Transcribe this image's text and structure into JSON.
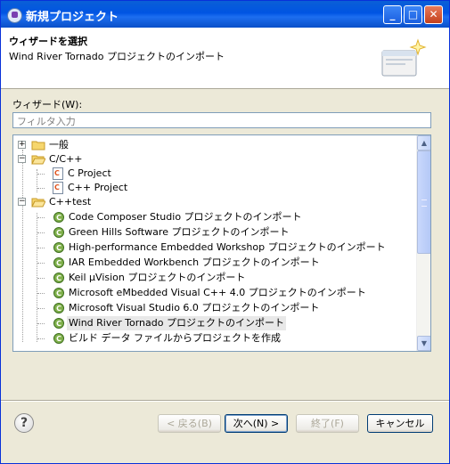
{
  "window": {
    "title": "新規プロジェクト"
  },
  "header": {
    "title": "ウィザードを選択",
    "description": "Wind River Tornado プロジェクトのインポート"
  },
  "wizards": {
    "label": "ウィザード(W):",
    "filter_placeholder": "フィルタ入力"
  },
  "tree": [
    {
      "label": "一般",
      "level": 0,
      "type": "folder",
      "expanded": false
    },
    {
      "label": "C/C++",
      "level": 0,
      "type": "folder",
      "expanded": true
    },
    {
      "label": "C Project",
      "level": 1,
      "type": "file"
    },
    {
      "label": "C++ Project",
      "level": 1,
      "type": "file"
    },
    {
      "label": "C++test",
      "level": 0,
      "type": "folder",
      "expanded": true
    },
    {
      "label": "Code Composer Studio プロジェクトのインポート",
      "level": 1,
      "type": "wizard"
    },
    {
      "label": "Green Hills Software プロジェクトのインポート",
      "level": 1,
      "type": "wizard"
    },
    {
      "label": "High-performance Embedded Workshop プロジェクトのインポート",
      "level": 1,
      "type": "wizard"
    },
    {
      "label": "IAR Embedded Workbench プロジェクトのインポート",
      "level": 1,
      "type": "wizard"
    },
    {
      "label": "Keil μVision プロジェクトのインポート",
      "level": 1,
      "type": "wizard"
    },
    {
      "label": "Microsoft eMbedded Visual C++ 4.0 プロジェクトのインポート",
      "level": 1,
      "type": "wizard"
    },
    {
      "label": "Microsoft Visual Studio 6.0 プロジェクトのインポート",
      "level": 1,
      "type": "wizard"
    },
    {
      "label": "Wind River Tornado プロジェクトのインポート",
      "level": 1,
      "type": "wizard",
      "selected": true
    },
    {
      "label": "ビルド データ ファイルからプロジェクトを作成",
      "level": 1,
      "type": "wizard"
    }
  ],
  "buttons": {
    "back": "< 戻る(B)",
    "next": "次へ(N) >",
    "finish": "終了(F)",
    "cancel": "キャンセル"
  },
  "colors": {
    "titlebar": "#0054e3",
    "accent": "#e0521e"
  },
  "icons": {
    "help": "?",
    "minimize": "_",
    "maximize": "□",
    "close": "✕",
    "scroll_up": "▲",
    "scroll_down": "▼"
  }
}
